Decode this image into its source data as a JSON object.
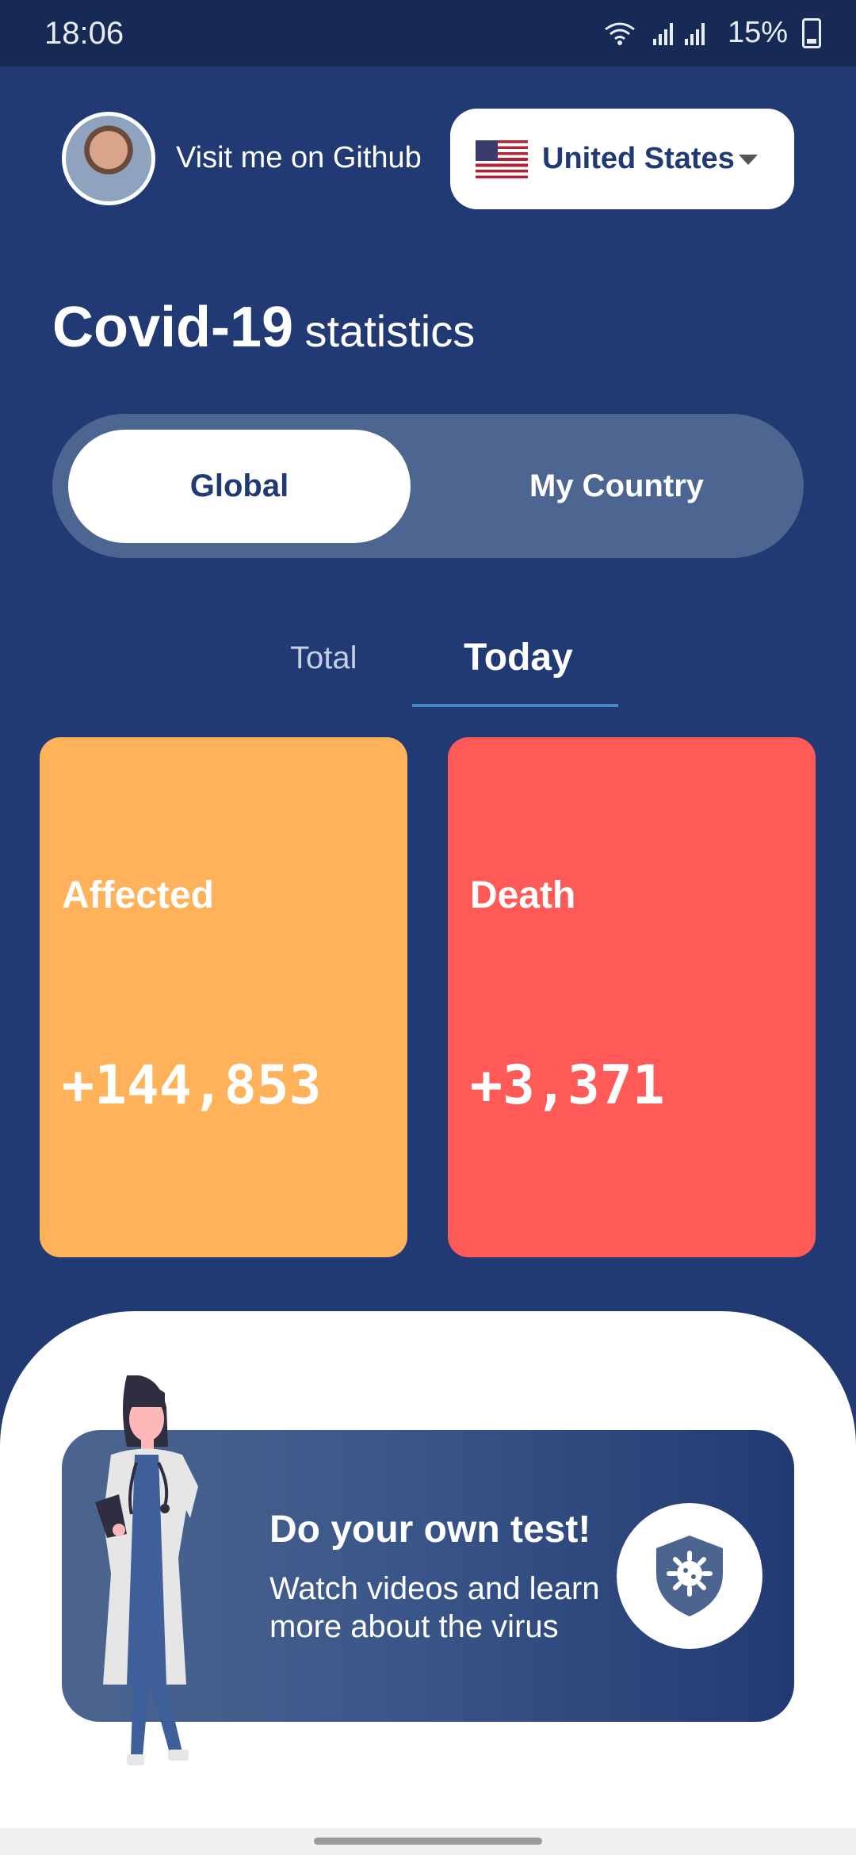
{
  "status_bar": {
    "time": "18:06",
    "battery": "15%"
  },
  "header": {
    "github_link": "Visit me on Github",
    "country": "United States"
  },
  "title": {
    "main": "Covid-19",
    "sub": "statistics"
  },
  "segmented": {
    "global": "Global",
    "my_country": "My Country",
    "selected": "Global"
  },
  "tabs": {
    "total": "Total",
    "today": "Today",
    "selected": "Today"
  },
  "cards": {
    "affected": {
      "label": "Affected",
      "value": "+144,853",
      "color": "#ffb259"
    },
    "death": {
      "label": "Death",
      "value": "+3,371",
      "color": "#ff5958"
    }
  },
  "promo": {
    "title": "Do your own test!",
    "subtitle": "Watch videos and learn more about the virus"
  },
  "icons": [
    "wifi-icon",
    "signal-icon",
    "battery-icon",
    "flag-icon",
    "caret-down-icon",
    "shield-virus-icon"
  ]
}
